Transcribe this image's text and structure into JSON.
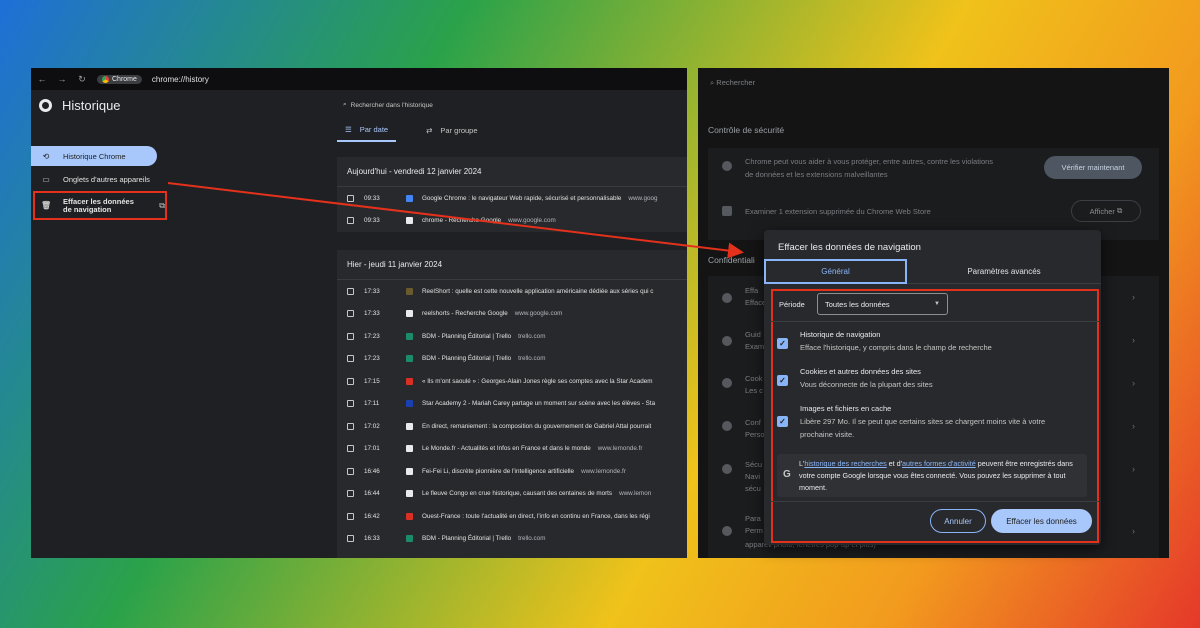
{
  "browser": {
    "chip_label": "Chrome",
    "url": "chrome://history"
  },
  "history_sidebar": {
    "title": "Historique",
    "items": [
      {
        "label": "Historique Chrome",
        "icon": "history-icon"
      },
      {
        "label": "Onglets d'autres appareils",
        "icon": "devices-icon"
      },
      {
        "label": "Effacer les données de navigation",
        "icon": "trash-icon"
      }
    ]
  },
  "history_main": {
    "search_placeholder": "Rechercher dans l'historique",
    "tabs": [
      {
        "label": "Par date",
        "active": true
      },
      {
        "label": "Par groupe",
        "active": false
      }
    ],
    "groups": [
      {
        "heading": "Aujourd'hui - vendredi 12 janvier 2024",
        "rows": [
          {
            "time": "09:33",
            "title": "Google Chrome : le navigateur Web rapide, sécurisé et personnalisable",
            "domain": "www.goog",
            "favicon_color": "#4285f4"
          },
          {
            "time": "09:33",
            "title": "chrome - Recherche Google",
            "domain": "www.google.com",
            "favicon_color": "#e8eaed"
          }
        ]
      },
      {
        "heading": "Hier - jeudi 11 janvier 2024",
        "rows": [
          {
            "time": "17:33",
            "title": "ReelShort : quelle est cette nouvelle application américaine dédiée aux séries qui c",
            "domain": "",
            "favicon_color": "#6b5a2e"
          },
          {
            "time": "17:33",
            "title": "reelshorts - Recherche Google",
            "domain": "www.google.com",
            "favicon_color": "#e8eaed"
          },
          {
            "time": "17:23",
            "title": "BDM - Planning Éditorial | Trello",
            "domain": "trello.com",
            "favicon_color": "#1c8b6a"
          },
          {
            "time": "17:23",
            "title": "BDM - Planning Éditorial | Trello",
            "domain": "trello.com",
            "favicon_color": "#1c8b6a"
          },
          {
            "time": "17:15",
            "title": "« Ils m'ont saoulé » : Georges-Alain Jones règle ses comptes avec la Star Academ",
            "domain": "",
            "favicon_color": "#d93025"
          },
          {
            "time": "17:11",
            "title": "Star Academy 2 - Mariah Carey partage un moment sur scène avec les élèves - Sta",
            "domain": "",
            "favicon_color": "#1a3fb0"
          },
          {
            "time": "17:02",
            "title": "En direct, remaniement : la composition du gouvernement de Gabriel Attal pourrait",
            "domain": "",
            "favicon_color": "#e8eaed"
          },
          {
            "time": "17:01",
            "title": "Le Monde.fr - Actualités et Infos en France et dans le monde",
            "domain": "www.lemonde.fr",
            "favicon_color": "#e8eaed"
          },
          {
            "time": "16:46",
            "title": "Fei-Fei Li, discrète pionnière de l'intelligence artificielle",
            "domain": "www.lemonde.fr",
            "favicon_color": "#e8eaed"
          },
          {
            "time": "16:44",
            "title": "Le fleuve Congo en crue historique, causant des centaines de morts",
            "domain": "www.lemon",
            "favicon_color": "#e8eaed"
          },
          {
            "time": "16:42",
            "title": "Ouest-France : toute l'actualité en direct, l'info en continu en France, dans les régi",
            "domain": "",
            "favicon_color": "#d93025"
          },
          {
            "time": "16:33",
            "title": "BDM - Planning Éditorial | Trello",
            "domain": "trello.com",
            "favicon_color": "#1c8b6a"
          }
        ]
      }
    ]
  },
  "settings": {
    "search_placeholder": "Rechercher",
    "safety_section": "Contrôle de sécurité",
    "safety_line1": "Chrome peut vous aider à vous protéger, entre autres, contre les violations",
    "safety_line2": "de données et les extensions malveillantes",
    "verify_button": "Vérifier maintenant",
    "extension_line": "Examiner 1 extension supprimée du Chrome Web Store",
    "show_button": "Afficher",
    "privacy_section_fragment": "Confidentiali",
    "fragments": [
      "Effa",
      "Efface",
      "Guid",
      "Exam",
      "Cook",
      "Les c",
      "Conf",
      "Perso",
      "Sécu",
      "Navi",
      "sécu",
      "Para",
      "Perm",
      "appareil photo, fenêtres pop-up et plus)"
    ]
  },
  "dialog": {
    "title": "Effacer les données de navigation",
    "tab_general": "Général",
    "tab_advanced": "Paramètres avancés",
    "period_label": "Période",
    "period_value": "Toutes les données",
    "options": [
      {
        "title": "Historique de navigation",
        "desc": "Efface l'historique, y compris dans le champ de recherche",
        "checked": true
      },
      {
        "title": "Cookies et autres données des sites",
        "desc": "Vous déconnecte de la plupart des sites",
        "checked": true
      },
      {
        "title": "Images et fichiers en cache",
        "desc": "Libère 297 Mo. Il se peut que certains sites se chargent moins vite à votre prochaine visite.",
        "checked": true
      }
    ],
    "info": {
      "prefix": "L'",
      "link1": "historique des recherches",
      "mid": " et d'",
      "link2": "autres formes d'activité",
      "suffix": " peuvent être enregistrés dans votre compte Google lorsque vous êtes connecté. Vous pouvez les supprimer à tout moment."
    },
    "cancel_button": "Annuler",
    "confirm_button": "Effacer les données"
  },
  "colors": {
    "highlight": "#e3311c",
    "accent": "#a8c7fa"
  }
}
